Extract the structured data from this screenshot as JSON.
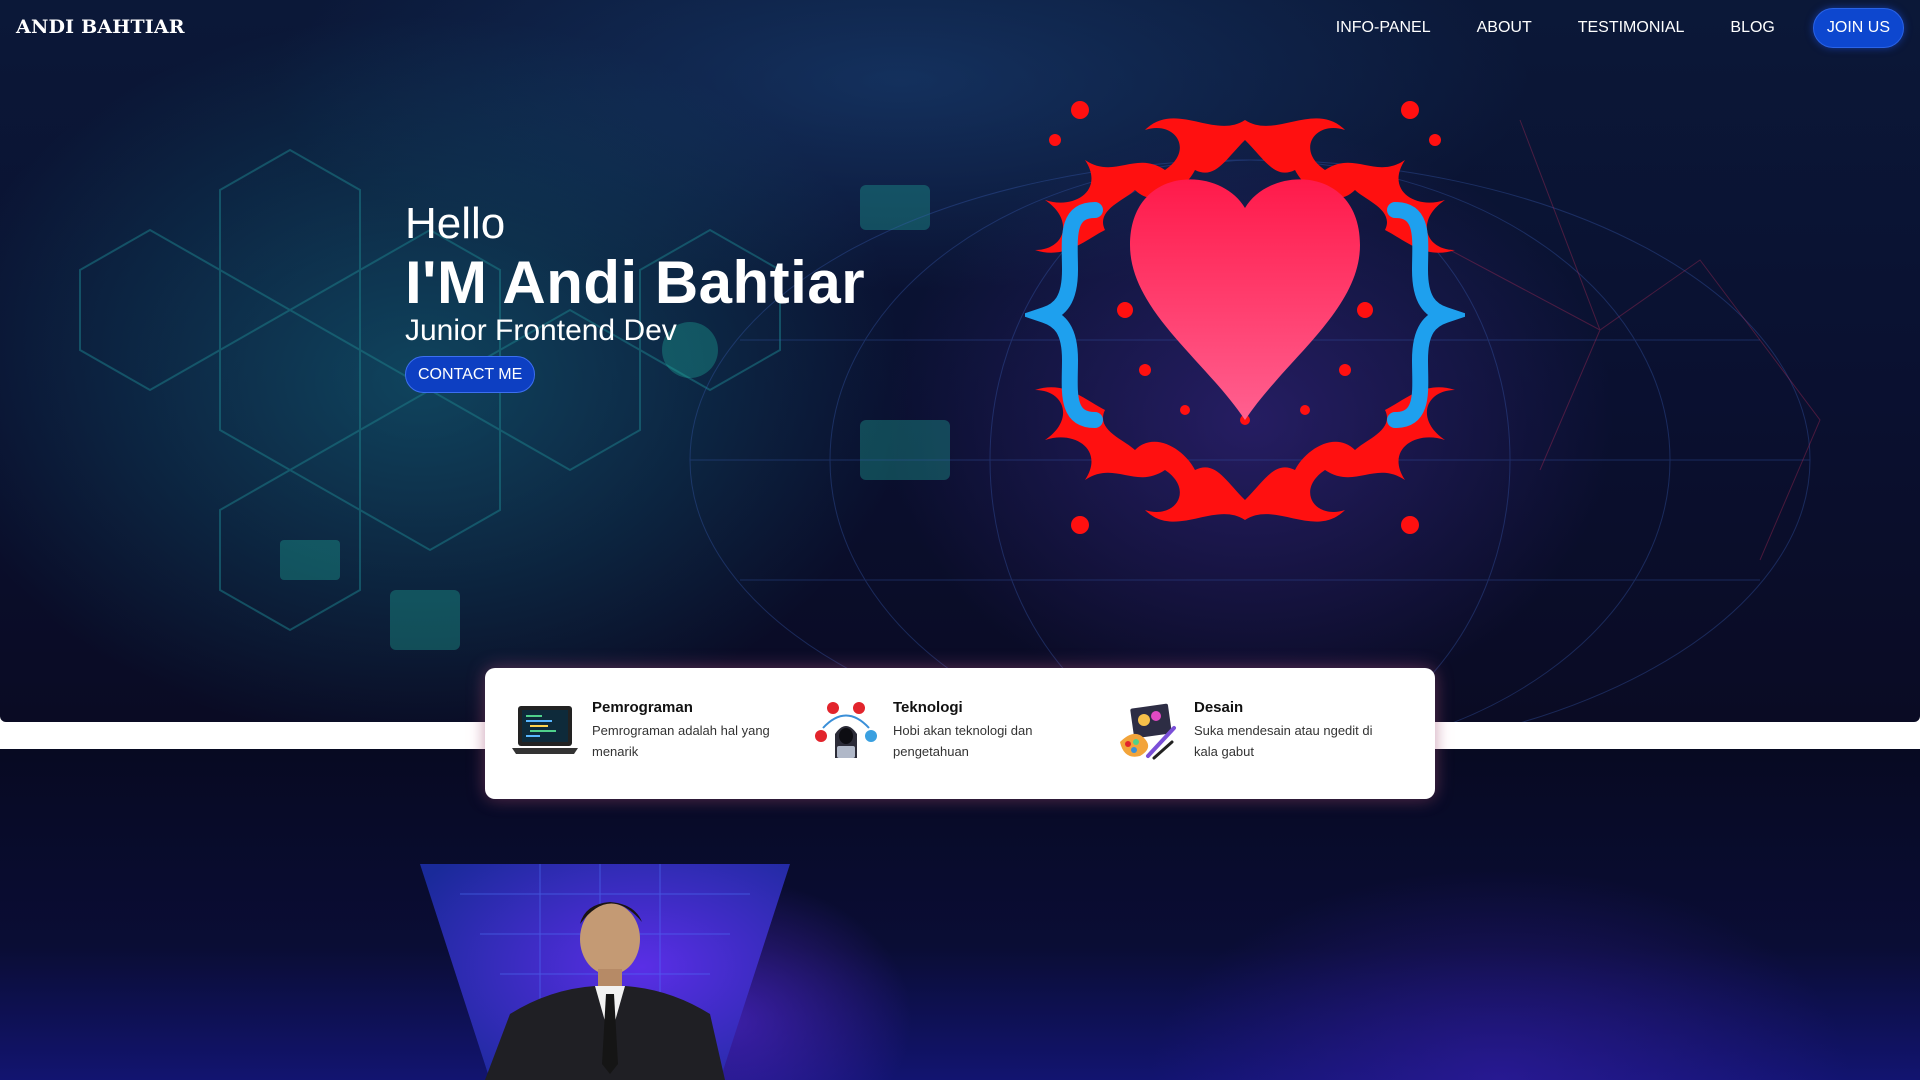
{
  "nav": {
    "brand": "ANDI BAHTIAR",
    "links": [
      "INFO-PANEL",
      "ABOUT",
      "TESTIMONIAL",
      "BLOG"
    ],
    "cta": "JOIN US"
  },
  "hero": {
    "greeting": "Hello",
    "name": "I'M Andi Bahtiar",
    "role": "Junior Frontend Dev",
    "button": "CONTACT ME"
  },
  "features": [
    {
      "title": "Pemrograman",
      "desc": "Pemrograman adalah hal yang menarik",
      "icon": "laptop-code-icon"
    },
    {
      "title": "Teknologi",
      "desc": "Hobi akan teknologi dan pengetahuan",
      "icon": "hacker-network-icon"
    },
    {
      "title": "Desain",
      "desc": "Suka mendesain atau ngedit di kala gabut",
      "icon": "design-tools-icon"
    }
  ],
  "colors": {
    "accent": "#0d47cf",
    "heart": "#ff2a5a",
    "brace": "#1ea0ee",
    "ornament": "#ff1010"
  }
}
